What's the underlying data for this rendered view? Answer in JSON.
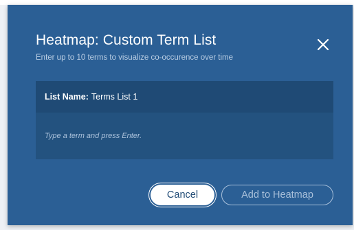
{
  "dialog": {
    "title": "Heatmap: Custom Term List",
    "subtitle": "Enter up to 10 terms to visualize co-occurence over time",
    "close_icon": "close-icon"
  },
  "term_list": {
    "name_label": "List Name:",
    "name_value": "Terms List 1",
    "input_value": "",
    "input_placeholder": "Type a term and press Enter."
  },
  "actions": {
    "cancel_label": "Cancel",
    "add_label": "Add to Heatmap",
    "add_enabled": false
  },
  "colors": {
    "dialog_bg": "#2b5f95",
    "panel_bg": "#23527f",
    "panel_header_bg": "#1f4a75",
    "muted_text": "#a9c0da"
  }
}
